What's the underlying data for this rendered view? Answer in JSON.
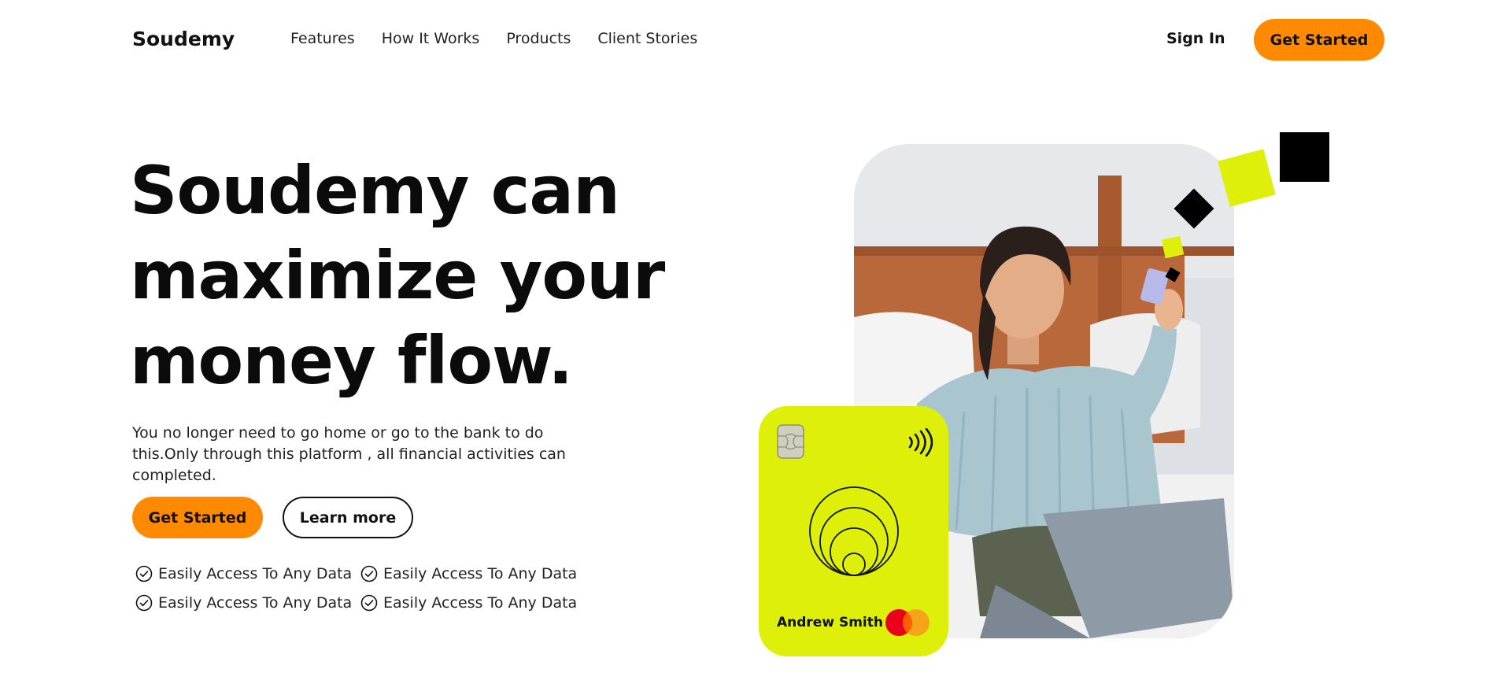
{
  "brand": {
    "name": "Soudemy",
    "accent": "#ff8a00",
    "card_color": "#def00a"
  },
  "nav": {
    "links": [
      "Features",
      "How It Works",
      "Products",
      "Client Stories"
    ],
    "sign_in": "Sign In",
    "cta": "Get Started"
  },
  "hero": {
    "headline_lines": [
      "Soudemy can",
      "maximize your",
      "money flow."
    ],
    "subtext": "You no longer need to go home or go to the bank to do this.Only through this platform , all financial activities can completed.",
    "primary_cta": "Get Started",
    "secondary_cta": "Learn more",
    "features": [
      "Easily Access To Any Data",
      "Easily Access To Any Data",
      "Easily Access To Any Data",
      "Easily Access To Any Data"
    ]
  },
  "card": {
    "holder_name": "Andrew Smith",
    "icons": [
      "chip-icon",
      "contactless-icon",
      "concentric-rings-icon",
      "mastercard-icon"
    ]
  },
  "icons": {
    "feature_bullet": "check-circle-icon"
  }
}
